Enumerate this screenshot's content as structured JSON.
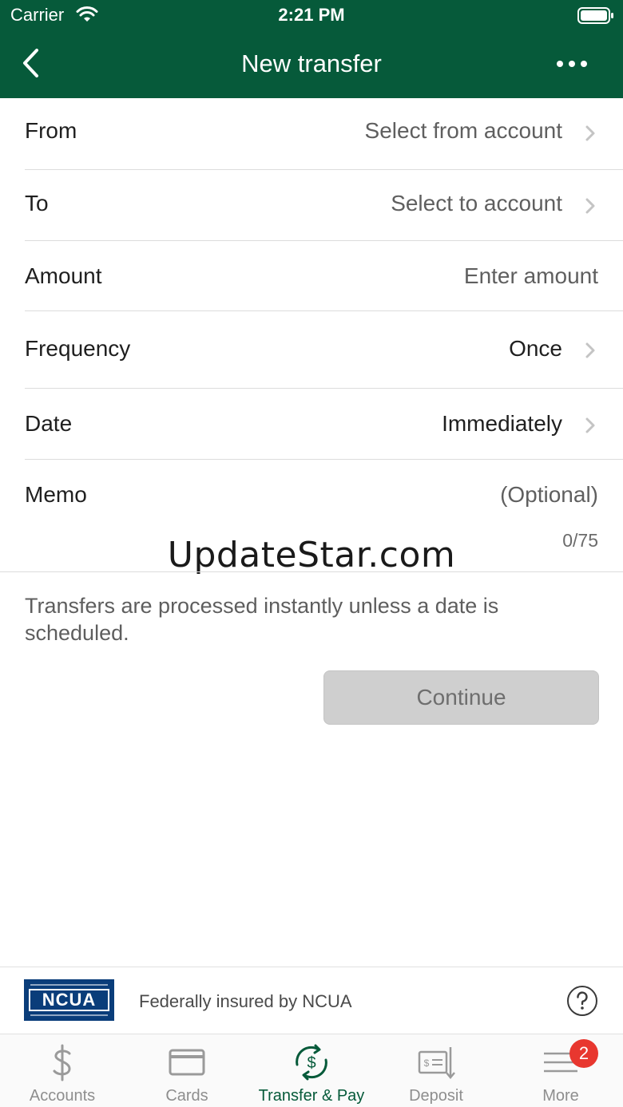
{
  "status_bar": {
    "carrier": "Carrier",
    "time": "2:21 PM"
  },
  "header": {
    "title": "New transfer"
  },
  "form": {
    "from": {
      "label": "From",
      "value": "Select from account"
    },
    "to": {
      "label": "To",
      "value": "Select to account"
    },
    "amount": {
      "label": "Amount",
      "placeholder": "Enter amount"
    },
    "frequency": {
      "label": "Frequency",
      "value": "Once"
    },
    "date": {
      "label": "Date",
      "value": "Immediately"
    },
    "memo": {
      "label": "Memo",
      "placeholder": "(Optional)",
      "counter": "0/75"
    }
  },
  "watermark": "UpdateStar.com",
  "info_text": "Transfers are processed instantly unless a date is scheduled.",
  "continue_label": "Continue",
  "ncua": {
    "logo_text": "NCUA",
    "text": "Federally insured by NCUA"
  },
  "tabs": [
    {
      "label": "Accounts",
      "icon": "dollar-icon"
    },
    {
      "label": "Cards",
      "icon": "card-icon"
    },
    {
      "label": "Transfer & Pay",
      "icon": "transfer-pay-icon",
      "active": true
    },
    {
      "label": "Deposit",
      "icon": "deposit-check-icon"
    },
    {
      "label": "More",
      "icon": "menu-icon",
      "badge": "2"
    }
  ],
  "colors": {
    "brand": "#065a3a",
    "badge": "#e8372f",
    "disabled_button": "#cfcfcf"
  }
}
